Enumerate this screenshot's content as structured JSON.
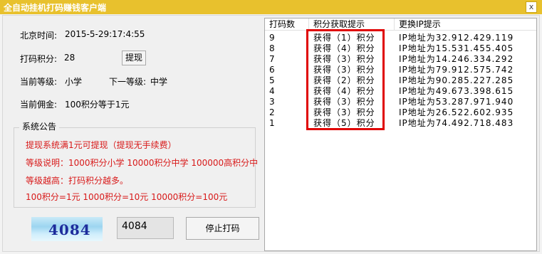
{
  "window": {
    "title": "全自动挂机打码赚钱客户端",
    "close_label": "x"
  },
  "info": {
    "time_label": "北京时间:",
    "time_value": "2015-5-29:17:4:55",
    "points_label": "打码积分:",
    "points_value": "28",
    "withdraw_button": "提现",
    "level_label": "当前等级:",
    "level_value": "小学",
    "next_level_label": "下一等级:",
    "next_level_value": "中学",
    "commission_label": "当前佣金:",
    "commission_value": "100积分等于1元"
  },
  "notice": {
    "title": "系统公告",
    "lines": [
      "提现系统满1元可提现（提现无手续费）",
      "等级说明：1000积分小学    10000积分中学    100000高积分中",
      "等级越高：打码积分越多。",
      "100积分=1元    1000积分=10元    10000积分=100元"
    ]
  },
  "captcha": {
    "image_text": "4084",
    "input_value": "4084"
  },
  "stop_button": "停止打码",
  "table": {
    "headers": [
      "打码数",
      "积分获取提示",
      "更换IP提示"
    ],
    "rows": [
      [
        "9",
        "获得（1）积分",
        "IP地址为32.912.429.119"
      ],
      [
        "8",
        "获得（4）积分",
        "IP地址为15.531.455.405"
      ],
      [
        "7",
        "获得（3）积分",
        "IP地址为14.246.334.292"
      ],
      [
        "6",
        "获得（3）积分",
        "IP地址为79.912.575.742"
      ],
      [
        "5",
        "获得（2）积分",
        "IP地址为90.285.227.285"
      ],
      [
        "4",
        "获得（4）积分",
        "IP地址为49.673.398.615"
      ],
      [
        "3",
        "获得（3）积分",
        "IP地址为53.287.971.940"
      ],
      [
        "2",
        "获得（3）积分",
        "IP地址为26.522.602.935"
      ],
      [
        "1",
        "获得（5）积分",
        "IP地址为74.492.718.483"
      ]
    ]
  },
  "colors": {
    "titlebar": "#e8c12d",
    "notice_text": "#d81919",
    "highlight_box": "#e00000",
    "captcha_text": "#1d2c9c"
  }
}
